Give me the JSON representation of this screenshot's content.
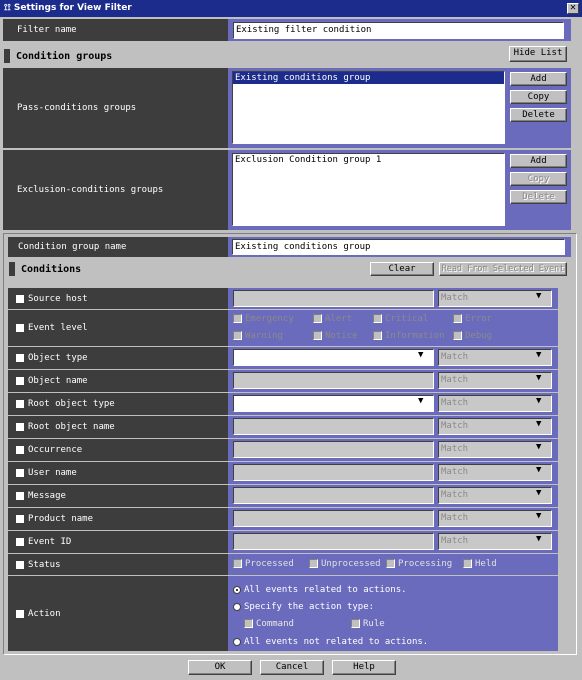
{
  "window": {
    "title": "Settings for View Filter",
    "close": "✕"
  },
  "filter_name": {
    "label": "Filter name",
    "value": "Existing filter condition"
  },
  "condition_groups": {
    "title": "Condition groups",
    "hide_list": "Hide List",
    "pass": {
      "label": "Pass-conditions groups",
      "items": [
        "Existing conditions group"
      ],
      "add": "Add",
      "copy": "Copy",
      "delete": "Delete"
    },
    "exclusion": {
      "label": "Exclusion-conditions groups",
      "items": [
        "Exclusion Condition group 1"
      ],
      "add": "Add",
      "copy": "Copy",
      "delete": "Delete"
    }
  },
  "group_name": {
    "label": "Condition group name",
    "value": "Existing conditions group"
  },
  "conditions": {
    "title": "Conditions",
    "clear": "Clear",
    "read_from_event": "Read From Selected Event",
    "source_host": {
      "label": "Source host",
      "match": "Match"
    },
    "event_level": {
      "label": "Event level",
      "levels": [
        "Emergency",
        "Alert",
        "Critical",
        "Error",
        "Warning",
        "Notice",
        "Information",
        "Debug"
      ]
    },
    "object_type": {
      "label": "Object type",
      "value": "",
      "match": "Match"
    },
    "object_name": {
      "label": "Object name",
      "match": "Match"
    },
    "root_object_type": {
      "label": "Root object type",
      "value": "",
      "match": "Match"
    },
    "root_object_name": {
      "label": "Root object name",
      "match": "Match"
    },
    "occurrence": {
      "label": "Occurrence",
      "match": "Match"
    },
    "user_name": {
      "label": "User name",
      "match": "Match"
    },
    "message": {
      "label": "Message",
      "match": "Match"
    },
    "product_name": {
      "label": "Product name",
      "match": "Match"
    },
    "event_id": {
      "label": "Event ID",
      "match": "Match"
    },
    "status": {
      "label": "Status",
      "options": [
        "Processed",
        "Unprocessed",
        "Processing",
        "Held"
      ]
    },
    "action": {
      "label": "Action",
      "all_related": "All events related to actions.",
      "specify": "Specify the action type:",
      "command": "Command",
      "rule": "Rule",
      "not_related": "All events not related to actions."
    }
  },
  "footer": {
    "ok": "OK",
    "cancel": "Cancel",
    "help": "Help"
  },
  "colors": {
    "title_bar": "#1c2c8c",
    "dark_panel": "#3d3d3d",
    "accent": "#6b6bbd"
  }
}
